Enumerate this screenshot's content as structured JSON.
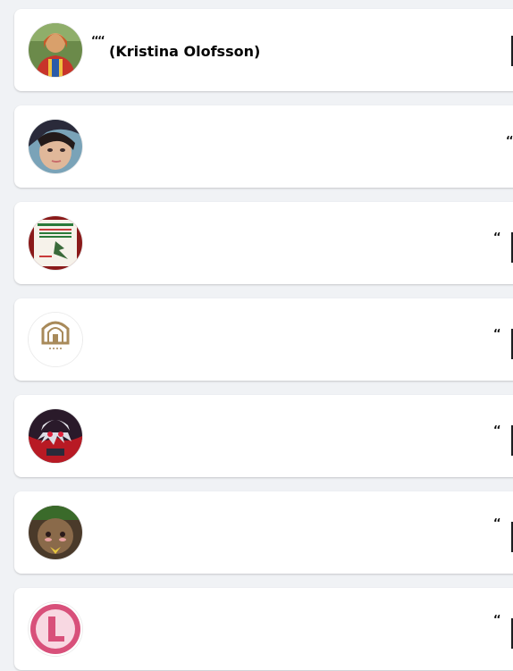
{
  "profiles": [
    {
      "mark": "‘‘‘‘",
      "name": "(Kristina Olofsson)",
      "avatar_icon": "woman-portrait-avatar"
    },
    {
      "mark": "‘‘",
      "name": "",
      "avatar_icon": "girl-selfie-avatar"
    },
    {
      "mark": "‘‘",
      "name": "",
      "avatar_icon": "shop-flyer-avatar"
    },
    {
      "mark": "‘‘",
      "name": "",
      "avatar_icon": "hotel-logo-avatar"
    },
    {
      "mark": "‘‘",
      "name": "",
      "avatar_icon": "anime-character-avatar"
    },
    {
      "mark": "‘‘",
      "name": "",
      "avatar_icon": "face-cookie-avatar"
    },
    {
      "mark": "‘‘",
      "name": "",
      "avatar_icon": "letter-l-logo-avatar"
    }
  ]
}
